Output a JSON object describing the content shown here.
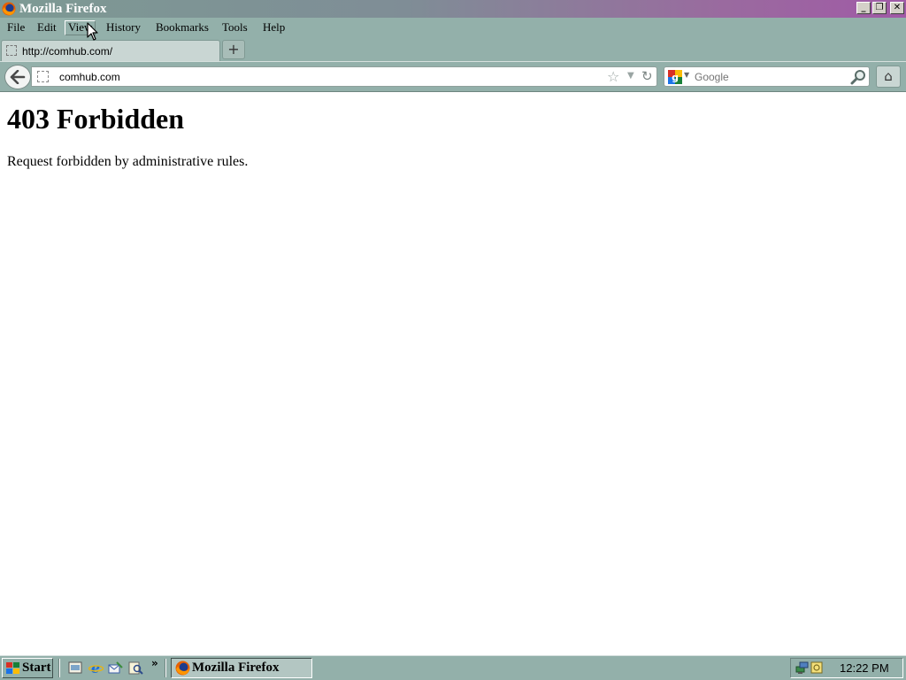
{
  "window": {
    "title": "Mozilla Firefox",
    "buttons": {
      "minimize": "_",
      "maximize": "❐",
      "close": "✕"
    }
  },
  "menu": {
    "items": [
      "File",
      "Edit",
      "View",
      "History",
      "Bookmarks",
      "Tools",
      "Help"
    ],
    "hovered": "View"
  },
  "tabs": {
    "items": [
      {
        "label": "http://comhub.com/",
        "active": true
      }
    ],
    "new_tab_symbol": "+"
  },
  "navbar": {
    "back_symbol": "🡐",
    "url": "comhub.com",
    "search_placeholder": "Google",
    "home_symbol": "⌂",
    "star_symbol": "☆",
    "dropmarker_symbol": "▼",
    "reload_symbol": "↻"
  },
  "page": {
    "heading": "403 Forbidden",
    "message": "Request forbidden by administrative rules."
  },
  "taskbar": {
    "start_label": "Start",
    "more_symbol": "»",
    "tasks": [
      {
        "label": "Mozilla Firefox",
        "active": true
      }
    ],
    "clock": "12:22 PM"
  },
  "colors": {
    "chrome": "#93b0aa",
    "titlebar_start": "#7d9a94",
    "titlebar_end": "#a05aa6"
  },
  "icons": {
    "app": "firefox-icon",
    "start": "windows-logo-icon",
    "quick_launch": [
      "show-desktop-icon",
      "internet-explorer-icon",
      "outlook-express-icon",
      "search-icon"
    ],
    "tray": [
      "network-icon",
      "ime-icon"
    ]
  }
}
